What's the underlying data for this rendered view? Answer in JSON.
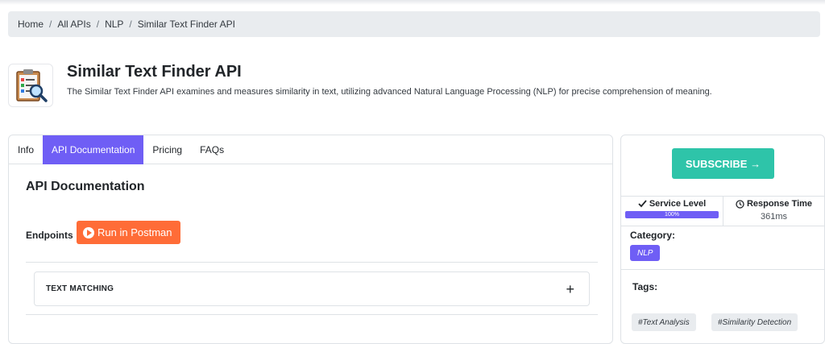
{
  "breadcrumb": {
    "items": [
      "Home",
      "All APIs",
      "NLP"
    ],
    "current": "Similar Text Finder API",
    "separator": "/"
  },
  "api": {
    "title": "Similar Text Finder API",
    "description": "The Similar Text Finder API examines and measures similarity in text, utilizing advanced Natural Language Processing (NLP) for precise comprehension of meaning."
  },
  "tabs": [
    {
      "label": "Info",
      "active": false
    },
    {
      "label": "API Documentation",
      "active": true
    },
    {
      "label": "Pricing",
      "active": false
    },
    {
      "label": "FAQs",
      "active": false
    }
  ],
  "docs": {
    "heading": "API Documentation",
    "endpoints_label": "Endpoints",
    "postman_label": "Run in Postman",
    "accordion_label": "TEXT MATCHING",
    "accordion_icon": "+"
  },
  "sidebar": {
    "subscribe_label": "SUBSCRIBE →",
    "service_level_label": "Service Level",
    "service_level_value": "100%",
    "service_level_fraction": 1.0,
    "response_time_label": "Response Time",
    "response_time_value": "361ms",
    "category_label": "Category:",
    "category": "NLP",
    "tags_label": "Tags:",
    "tags": [
      "#Text Analysis",
      "#Similarity Detection"
    ]
  },
  "colors": {
    "accent": "#6f5ef5",
    "subscribe": "#2ec4a9",
    "postman": "#ff6c37"
  }
}
